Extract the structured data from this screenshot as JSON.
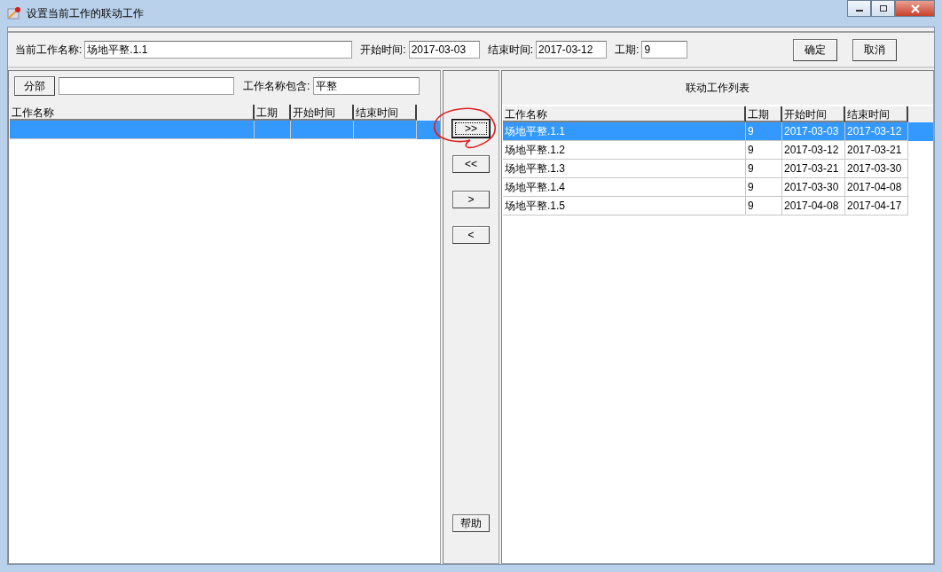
{
  "window": {
    "title": "设置当前工作的联动工作"
  },
  "form": {
    "fields": [
      {
        "label": "当前工作名称:",
        "value": "场地平整.1.1",
        "kind": "wide"
      },
      {
        "label": "开始时间:",
        "value": "2017-03-03",
        "kind": "date"
      },
      {
        "label": "结束时间:",
        "value": "2017-03-12",
        "kind": "date"
      },
      {
        "label": "工期:",
        "value": "9",
        "kind": "short"
      }
    ],
    "buttons": [
      "确定",
      "取消"
    ]
  },
  "left": {
    "division_button": "分部",
    "filter_label": "工作名称包含:",
    "filter_value": "平整",
    "table": {
      "columns": [
        "工作名称",
        "工期",
        "开始时间",
        "结束时间"
      ],
      "rows": [
        {
          "selected": true,
          "cells": []
        }
      ]
    }
  },
  "middle": {
    "buttons": [
      {
        "label": ">>",
        "focused": true
      },
      {
        "label": "<<",
        "focused": false
      },
      {
        "label": ">",
        "focused": false
      },
      {
        "label": "<",
        "focused": false
      }
    ],
    "help": "帮助"
  },
  "right": {
    "title": "联动工作列表",
    "table": {
      "columns": [
        "工作名称",
        "工期",
        "开始时间",
        "结束时间"
      ],
      "rows": [
        {
          "selected": true,
          "cells": [
            "场地平整.1.1",
            "9",
            "2017-03-03",
            "2017-03-12"
          ]
        },
        {
          "selected": false,
          "cells": [
            "场地平整.1.2",
            "9",
            "2017-03-12",
            "2017-03-21"
          ]
        },
        {
          "selected": false,
          "cells": [
            "场地平整.1.3",
            "9",
            "2017-03-21",
            "2017-03-30"
          ]
        },
        {
          "selected": false,
          "cells": [
            "场地平整.1.4",
            "9",
            "2017-03-30",
            "2017-04-08"
          ]
        },
        {
          "selected": false,
          "cells": [
            "场地平整.1.5",
            "9",
            "2017-04-08",
            "2017-04-17"
          ]
        }
      ]
    }
  }
}
